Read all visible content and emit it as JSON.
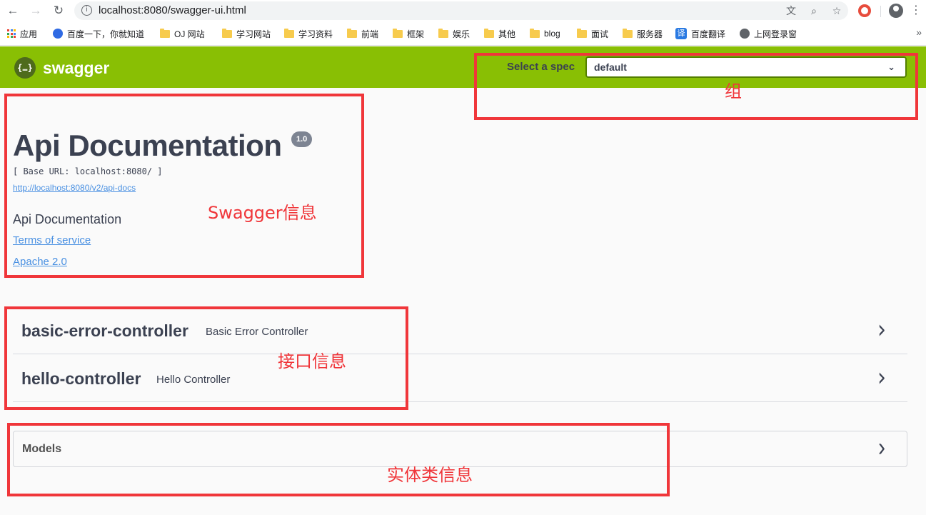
{
  "browser": {
    "url": "localhost:8080/swagger-ui.html",
    "bookmarks": [
      {
        "label": "应用",
        "icon": "apps-grid-icon"
      },
      {
        "label": "百度一下，你就知道",
        "icon": "baidu-icon"
      },
      {
        "label": "OJ 网站",
        "icon": "folder-icon"
      },
      {
        "label": "学习网站",
        "icon": "folder-icon"
      },
      {
        "label": "学习资料",
        "icon": "folder-icon"
      },
      {
        "label": "前端",
        "icon": "folder-icon"
      },
      {
        "label": "框架",
        "icon": "folder-icon"
      },
      {
        "label": "娱乐",
        "icon": "folder-icon"
      },
      {
        "label": "其他",
        "icon": "folder-icon"
      },
      {
        "label": "blog",
        "icon": "folder-icon"
      },
      {
        "label": "面试",
        "icon": "folder-icon"
      },
      {
        "label": "服务器",
        "icon": "folder-icon"
      },
      {
        "label": "百度翻译",
        "icon": "translate-icon"
      },
      {
        "label": "上网登录窗",
        "icon": "globe-icon"
      }
    ]
  },
  "swagger": {
    "logo_text": "swagger",
    "logo_glyph": "{…}",
    "spec_label": "Select a spec",
    "spec_value": "default"
  },
  "info": {
    "title": "Api Documentation",
    "version": "1.0",
    "base_url": "[ Base URL: localhost:8080/ ]",
    "api_docs_link": "http://localhost:8080/v2/api-docs",
    "description": "Api Documentation",
    "terms": "Terms of service",
    "license": "Apache 2.0"
  },
  "tags": [
    {
      "name": "basic-error-controller",
      "description": "Basic Error Controller"
    },
    {
      "name": "hello-controller",
      "description": "Hello Controller"
    }
  ],
  "models": {
    "label": "Models"
  },
  "annotations": {
    "group": "组",
    "swagger_info": "Swagger信息",
    "api_info": "接口信息",
    "entity_info": "实体类信息",
    "color": "#f0363a"
  },
  "colors": {
    "topbar": "#89bf04",
    "link": "#4990e2",
    "text": "#3b4151"
  }
}
